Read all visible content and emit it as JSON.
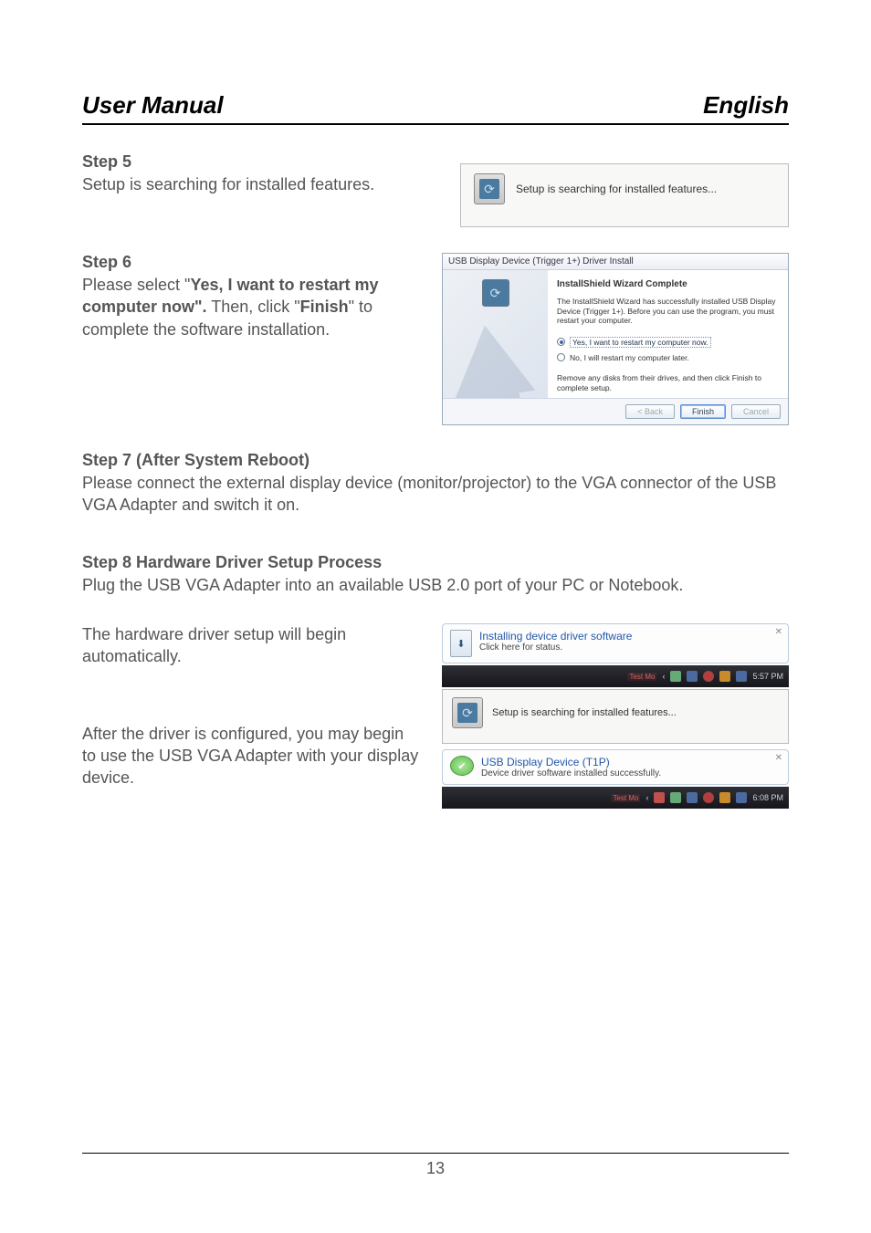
{
  "header": {
    "left": "User Manual",
    "right": "English"
  },
  "step5": {
    "heading": "Step 5",
    "text": "Setup is searching for installed features.",
    "scr_text": "Setup is searching for installed features..."
  },
  "step6": {
    "heading": "Step 6",
    "text_pre": "Please select \"",
    "bold1": "Yes, I want to restart my computer now\".",
    "text_mid": "  Then, click \"",
    "bold2": "Finish",
    "text_end": "\" to complete the software installation.",
    "dlg": {
      "title": "USB Display Device (Trigger 1+) Driver Install",
      "h": "InstallShield Wizard Complete",
      "p": "The InstallShield Wizard has successfully installed USB Display Device (Trigger 1+). Before you can use the program, you must restart your computer.",
      "opt_yes": "Yes, I want to restart my computer now.",
      "opt_no": "No, I will restart my computer later.",
      "note": "Remove any disks from their drives, and then click Finish to complete setup.",
      "back": "< Back",
      "finish": "Finish",
      "cancel": "Cancel"
    }
  },
  "step7": {
    "heading": "Step 7 (After System Reboot)",
    "text": "Please connect the external display device (monitor/projector) to the VGA connector of the USB VGA Adapter and switch it on."
  },
  "step8": {
    "heading": "Step 8 Hardware Driver Setup Process",
    "text": "Plug the USB VGA Adapter into an available USB 2.0 port of your PC or Notebook.",
    "para_a": "The hardware driver setup will begin automatically.",
    "para_b": "After the driver is configured, you may begin to use the USB VGA Adapter with your display device.",
    "balloon1": {
      "title": "Installing device driver software",
      "sub": "Click here for status."
    },
    "taskbar1_time": "5:57 PM",
    "scr3_text": "Setup is searching for installed features...",
    "balloon2": {
      "title": "USB Display Device (T1P)",
      "sub": "Device driver software installed successfully."
    },
    "taskbar2_time": "6:08 PM",
    "test_tag": "Test Mo"
  },
  "page_number": "13"
}
